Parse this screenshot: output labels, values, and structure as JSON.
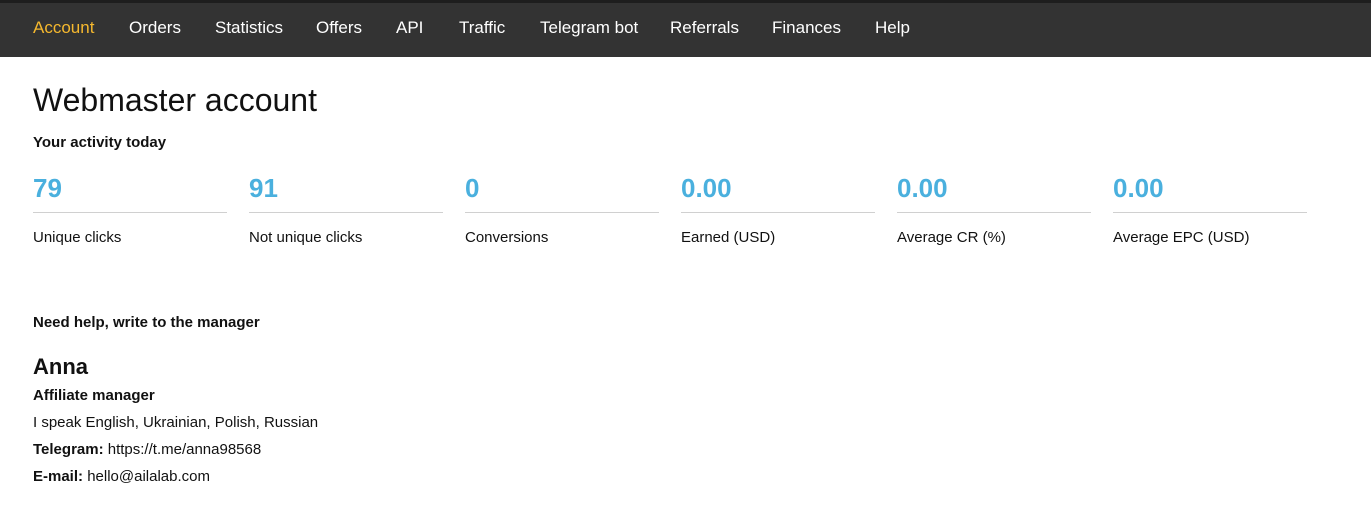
{
  "nav": {
    "items": [
      {
        "label": "Account",
        "active": true
      },
      {
        "label": "Orders"
      },
      {
        "label": "Statistics"
      },
      {
        "label": "Offers"
      },
      {
        "label": "API"
      },
      {
        "label": "Traffic"
      },
      {
        "label": "Telegram bot"
      },
      {
        "label": "Referrals"
      },
      {
        "label": "Finances"
      },
      {
        "label": "Help"
      }
    ]
  },
  "page": {
    "title": "Webmaster account",
    "activity_heading": "Your activity today"
  },
  "stats": [
    {
      "value": "79",
      "label": "Unique clicks"
    },
    {
      "value": "91",
      "label": "Not unique clicks"
    },
    {
      "value": "0",
      "label": "Conversions"
    },
    {
      "value": "0.00",
      "label": "Earned (USD)"
    },
    {
      "value": "0.00",
      "label": "Average CR (%)"
    },
    {
      "value": "0.00",
      "label": "Average EPC (USD)"
    }
  ],
  "manager": {
    "heading": "Need help, write to the manager",
    "name": "Anna",
    "role": "Affiliate manager",
    "languages": "I speak English, Ukrainian, Polish, Russian",
    "telegram_label": "Telegram:",
    "telegram_value": "https://t.me/anna98568",
    "email_label": "E-mail:",
    "email_value": "hello@ailalab.com"
  },
  "colors": {
    "nav_background": "#333333",
    "nav_active": "#f5b82e",
    "stat_value": "#4ab0de"
  }
}
